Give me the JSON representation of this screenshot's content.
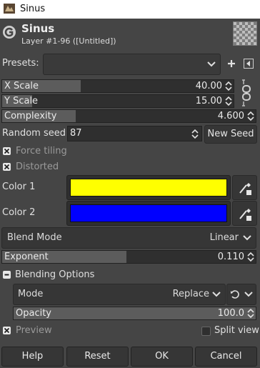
{
  "window": {
    "title": "Sinus"
  },
  "header": {
    "title": "Sinus",
    "subtitle": "Layer #1-96 ([Untitled])"
  },
  "presets": {
    "label": "Presets:",
    "value": ""
  },
  "x_scale": {
    "label": "X Scale",
    "value": "40.00",
    "fraction": 0.34
  },
  "y_scale": {
    "label": "Y Scale",
    "value": "15.00",
    "fraction": 0.13
  },
  "complexity": {
    "label": "Complexity",
    "value": "4.600",
    "fraction": 0.29
  },
  "random_seed": {
    "label": "Random seed",
    "value": "87",
    "new_seed_label": "New Seed"
  },
  "force_tiling": {
    "label": "Force tiling",
    "checked": true
  },
  "distorted": {
    "label": "Distorted",
    "checked": true
  },
  "color1": {
    "label": "Color 1",
    "color": "#ffff00"
  },
  "color2": {
    "label": "Color 2",
    "color": "#0000ff"
  },
  "blend_mode": {
    "label": "Blend Mode",
    "value": "Linear"
  },
  "exponent": {
    "label": "Exponent",
    "value": "0.110",
    "fraction": 0.49
  },
  "blending_options": {
    "label": "Blending Options",
    "expanded": true,
    "mode_label": "Mode",
    "mode_value": "Replace",
    "opacity_label": "Opacity",
    "opacity_value": "100.0",
    "opacity_fraction": 1.0
  },
  "preview": {
    "label": "Preview",
    "checked": true
  },
  "split_view": {
    "label": "Split view",
    "checked": false
  },
  "buttons": {
    "help": "Help",
    "reset": "Reset",
    "ok": "OK",
    "cancel": "Cancel"
  },
  "icons": {
    "add": "plus-icon",
    "menu": "menu-arrow-icon",
    "chain": "chain-link-icon",
    "picker": "color-picker-icon",
    "reset_mode": "mode-reset-icon"
  },
  "colors": {
    "background": "#454545",
    "field": "#2f2f2f",
    "fill": "#5c5c5c"
  }
}
